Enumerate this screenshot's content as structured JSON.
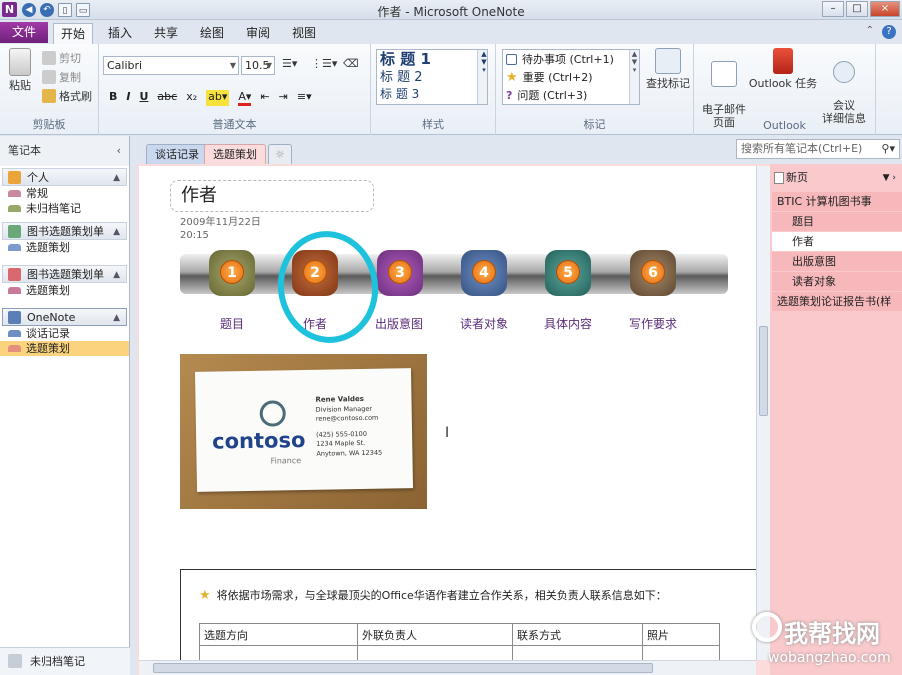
{
  "window": {
    "title": "作者 - Microsoft OneNote",
    "app_icon": "N",
    "controls": [
      "–",
      "□",
      "×"
    ]
  },
  "ribbon_tabs": {
    "file": "文件",
    "tabs": [
      "开始",
      "插入",
      "共享",
      "绘图",
      "审阅",
      "视图"
    ],
    "active": "开始"
  },
  "clipboard": {
    "paste": "粘贴",
    "cut": "剪切",
    "copy": "复制",
    "format_painter": "格式刷",
    "label": "剪贴板"
  },
  "text": {
    "font": "Calibri",
    "size": "10.5",
    "bold": "B",
    "italic": "I",
    "underline": "U",
    "strike": "abc",
    "subscript": "x₂",
    "label": "普通文本"
  },
  "styles": {
    "items": [
      "标 题 1",
      "标 题 2",
      "标 题 3"
    ],
    "label": "样式"
  },
  "tags": {
    "items": [
      "待办事项 (Ctrl+1)",
      "重要 (Ctrl+2)",
      "问题 (Ctrl+3)"
    ],
    "find_tags": "查找标记",
    "label": "标记"
  },
  "outlook": {
    "email_page": "电子邮件\n页面",
    "outlook_task": "Outlook 任务",
    "meeting_details": "会议\n详细信息",
    "label": "Outlook"
  },
  "notebooks": {
    "header": "笔记本",
    "list": [
      {
        "name": "个人",
        "color": "#e9a53a",
        "sections": [
          {
            "name": "常规",
            "color": "#c98aa0"
          },
          {
            "name": "未归档笔记",
            "color": "#98a86b"
          }
        ]
      },
      {
        "name": "图书选题策划单",
        "color": "#6aa879",
        "sections": [
          {
            "name": "选题策划",
            "color": "#7a9bcc"
          }
        ]
      },
      {
        "name": "图书选题策划单",
        "color": "#d9686f",
        "sections": [
          {
            "name": "选题策划",
            "color": "#c97a9b"
          }
        ]
      },
      {
        "name": "OneNote",
        "color": "#5b7fb6",
        "sections": [
          {
            "name": "谈话记录",
            "color": "#6e8fc4"
          },
          {
            "name": "选题策划",
            "color": "#e5907f",
            "selected": true
          }
        ]
      }
    ],
    "unfiled": "未归档笔记"
  },
  "section_tabs": [
    "谈话记录",
    "选题策划"
  ],
  "search": {
    "placeholder": "搜索所有笔记本(Ctrl+E)"
  },
  "page": {
    "title": "作者",
    "date": "2009年11月22日",
    "time": "20:15",
    "steps": [
      {
        "num": "1",
        "label": "题目",
        "color": "#8a8a4a"
      },
      {
        "num": "2",
        "label": "作者",
        "color": "#a0522d"
      },
      {
        "num": "3",
        "label": "出版意图",
        "color": "#8e4a9b"
      },
      {
        "num": "4",
        "label": "读者对象",
        "color": "#4f6fa5"
      },
      {
        "num": "5",
        "label": "具体内容",
        "color": "#3c8a80"
      },
      {
        "num": "6",
        "label": "写作要求",
        "color": "#8b6b4a"
      }
    ],
    "card": {
      "brand": "contoso",
      "sub": "Finance",
      "name": "Rene Valdes",
      "role": "Division Manager",
      "email": "rene@contoso.com",
      "phone": "(425) 555-0100",
      "street": "1234 Maple St.",
      "city": "Anytown, WA 12345"
    },
    "note": "将依据市场需求，与全球最顶尖的Office华语作者建立合作关系，相关负责人联系信息如下：",
    "table_headers": [
      "选题方向",
      "外联负责人",
      "联系方式",
      "照片"
    ],
    "table_partial_row": [
      "",
      "",
      "",
      ""
    ]
  },
  "pages_pane": {
    "new_page": "新页",
    "pages": [
      {
        "name": "BTIC 计算机图书事",
        "level": "top"
      },
      {
        "name": "题目",
        "level": "sub"
      },
      {
        "name": "作者",
        "level": "sub",
        "active": true
      },
      {
        "name": "出版意图",
        "level": "sub"
      },
      {
        "name": "读者对象",
        "level": "sub"
      },
      {
        "name": "选题策划论证报告书(样",
        "level": "top"
      }
    ]
  },
  "watermark": {
    "cn": "我帮找网",
    "en": "wobangzhao.com"
  }
}
